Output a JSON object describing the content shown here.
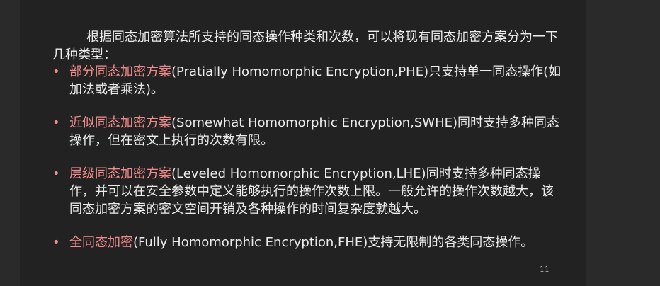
{
  "intro": "根据同态加密算法所支持的同态操作种类和次数，可以将现有同态加密方案分为一下几种类型：",
  "bullets": [
    {
      "name": "部分同态加密方案",
      "rest": "(Pratially Homomorphic Encryption,PHE)只支持单一同态操作(如加法或者乘法)。"
    },
    {
      "name": "近似同态加密方案",
      "rest": "(Somewhat Homomorphic Encryption,SWHE)同时支持多种同态操作，但在密文上执行的次数有限。"
    },
    {
      "name": "层级同态加密方案",
      "rest": "(Leveled Homomorphic Encryption,LHE)同时支持多种同态操作，并可以在安全参数中定义能够执行的操作次数上限。一般允许的操作次数越大，该同态加密方案的密文空间开销及各种操作的时间复杂度就越大。"
    },
    {
      "name": "全同态加密",
      "rest": "(Fully Homomorphic Encryption,FHE)支持无限制的各类同态操作。"
    }
  ],
  "bullet_glyph": "•",
  "page_number": "11",
  "colors": {
    "highlight": "#f28c8c",
    "text": "#ededed",
    "slide_bg": "#222222"
  }
}
